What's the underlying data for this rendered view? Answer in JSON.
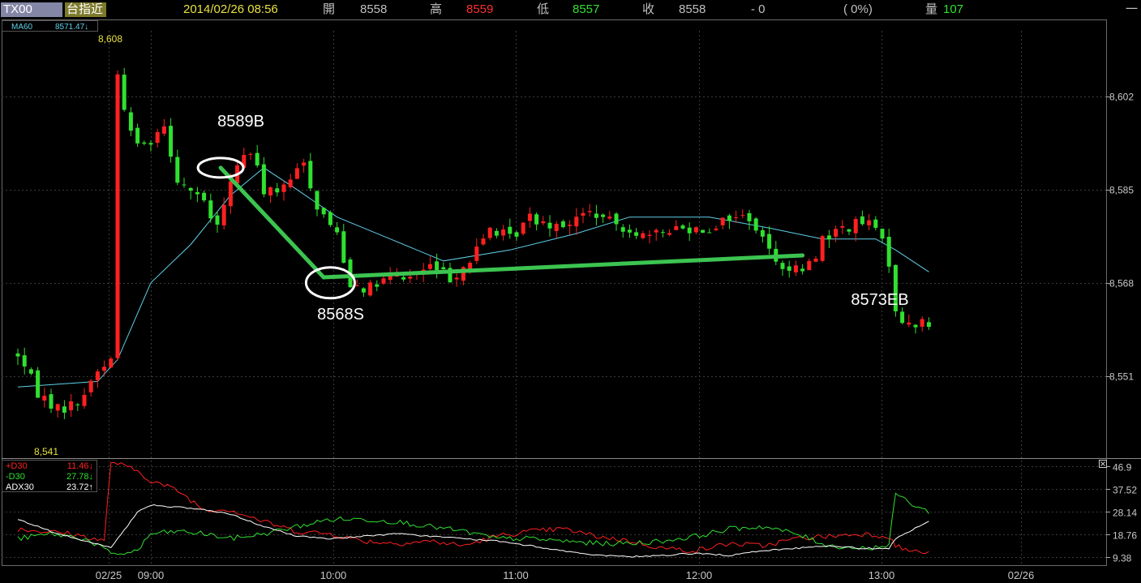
{
  "header": {
    "symbol": "TX00",
    "name": "台指近",
    "datetime": "2014/02/26 08:56",
    "open_label": "開",
    "open": "8558",
    "high_label": "高",
    "high": "8559",
    "low_label": "低",
    "low": "8557",
    "close_label": "收",
    "close": "8558",
    "change": "- 0",
    "change_pct": "( 0%)",
    "volume_label": "量",
    "volume": "107",
    "right_mark": "一"
  },
  "colors": {
    "up": "#ff2020",
    "down": "#30e030",
    "ma": "#5fd0e8",
    "grid": "#3a3a3a",
    "axis_text": "#c8c8c8",
    "plus_di": "#ff2020",
    "minus_di": "#30e030",
    "adx": "#ffffff",
    "trade_line": "#3cc450"
  },
  "chart_data": [
    {
      "type": "candlestick",
      "title": "",
      "ma_legend": {
        "label": "MA60",
        "value": "8571.47↓"
      },
      "y_ticks": [
        "8,602",
        "8,585",
        "8,568",
        "8,551"
      ],
      "ylim": [
        8536,
        8614
      ],
      "extremes": {
        "high": "8,608",
        "low": "8,541"
      },
      "x_ticks": [
        "02/25",
        "09:00",
        "10:00",
        "11:00",
        "12:00",
        "13:00",
        "02/26"
      ],
      "price_path": [
        [
          0,
          8555
        ],
        [
          3,
          8548
        ],
        [
          6,
          8545
        ],
        [
          9,
          8546
        ],
        [
          12,
          8552
        ],
        [
          14,
          8554
        ],
        [
          15,
          8606
        ],
        [
          17,
          8595
        ],
        [
          19,
          8593
        ],
        [
          22,
          8597
        ],
        [
          24,
          8587
        ],
        [
          27,
          8584
        ],
        [
          30,
          8578
        ],
        [
          33,
          8590
        ],
        [
          35,
          8592
        ],
        [
          37,
          8585
        ],
        [
          40,
          8585
        ],
        [
          43,
          8590
        ],
        [
          45,
          8582
        ],
        [
          48,
          8577
        ],
        [
          50,
          8568
        ],
        [
          53,
          8567
        ],
        [
          56,
          8569
        ],
        [
          59,
          8569
        ],
        [
          62,
          8571
        ],
        [
          65,
          8569
        ],
        [
          68,
          8572
        ],
        [
          71,
          8578
        ],
        [
          74,
          8576
        ],
        [
          77,
          8580
        ],
        [
          80,
          8579
        ],
        [
          83,
          8579
        ],
        [
          86,
          8581
        ],
        [
          89,
          8579
        ],
        [
          92,
          8578
        ],
        [
          95,
          8576
        ],
        [
          98,
          8578
        ],
        [
          101,
          8578
        ],
        [
          104,
          8578
        ],
        [
          107,
          8580
        ],
        [
          110,
          8580
        ],
        [
          113,
          8574
        ],
        [
          116,
          8570
        ],
        [
          119,
          8571
        ],
        [
          121,
          8576
        ],
        [
          124,
          8578
        ],
        [
          127,
          8579
        ],
        [
          129,
          8578
        ],
        [
          131,
          8572
        ],
        [
          132,
          8563
        ],
        [
          134,
          8560
        ],
        [
          136,
          8561
        ],
        [
          137,
          8560
        ]
      ],
      "ma60_path": [
        [
          0,
          8549
        ],
        [
          12,
          8550
        ],
        [
          15,
          8554
        ],
        [
          20,
          8568
        ],
        [
          26,
          8575
        ],
        [
          32,
          8584
        ],
        [
          37,
          8589
        ],
        [
          42,
          8585
        ],
        [
          48,
          8580
        ],
        [
          56,
          8576
        ],
        [
          64,
          8572
        ],
        [
          74,
          8574
        ],
        [
          84,
          8577
        ],
        [
          92,
          8580
        ],
        [
          104,
          8580
        ],
        [
          113,
          8578
        ],
        [
          121,
          8576
        ],
        [
          129,
          8576
        ],
        [
          132,
          8574
        ],
        [
          137,
          8570
        ]
      ],
      "annotations": [
        {
          "text": "8589B",
          "price": 8589,
          "bar": 30.5
        },
        {
          "text": "8568S",
          "price": 8568,
          "bar": 47
        },
        {
          "text": "8573EB",
          "price": 8573,
          "bar": 118
        }
      ],
      "trade_lines": [
        {
          "from": [
            30.5,
            8589
          ],
          "to": [
            46,
            8569
          ]
        },
        {
          "from": [
            46,
            8569
          ],
          "to": [
            118,
            8573
          ]
        }
      ]
    },
    {
      "type": "line",
      "title": "",
      "series": [
        {
          "name": "+D30",
          "value": "11.46↓",
          "color": "#ff2020",
          "values": [
            [
              0,
              21
            ],
            [
              8,
              19
            ],
            [
              13,
              16
            ],
            [
              14,
              49
            ],
            [
              18,
              45
            ],
            [
              20,
              41
            ],
            [
              24,
              37
            ],
            [
              28,
              29
            ],
            [
              32,
              29
            ],
            [
              37,
              24
            ],
            [
              42,
              20
            ],
            [
              47,
              19
            ],
            [
              52,
              16
            ],
            [
              57,
              15
            ],
            [
              62,
              16
            ],
            [
              67,
              14
            ],
            [
              72,
              18
            ],
            [
              77,
              20
            ],
            [
              82,
              21
            ],
            [
              87,
              18
            ],
            [
              92,
              16
            ],
            [
              97,
              13
            ],
            [
              102,
              12
            ],
            [
              107,
              15
            ],
            [
              112,
              14
            ],
            [
              117,
              17
            ],
            [
              122,
              18
            ],
            [
              127,
              19
            ],
            [
              131,
              18
            ],
            [
              132,
              14
            ],
            [
              134,
              12
            ],
            [
              137,
              11
            ]
          ]
        },
        {
          "name": "-D30",
          "value": "27.78↓",
          "color": "#30e030",
          "values": [
            [
              0,
              17
            ],
            [
              5,
              19
            ],
            [
              10,
              17
            ],
            [
              13,
              13
            ],
            [
              14,
              10
            ],
            [
              18,
              12
            ],
            [
              20,
              19
            ],
            [
              24,
              20
            ],
            [
              28,
              19
            ],
            [
              32,
              17
            ],
            [
              37,
              19
            ],
            [
              42,
              22
            ],
            [
              47,
              25
            ],
            [
              52,
              25
            ],
            [
              57,
              24
            ],
            [
              62,
              22
            ],
            [
              67,
              20
            ],
            [
              72,
              17
            ],
            [
              77,
              17
            ],
            [
              82,
              16
            ],
            [
              87,
              15
            ],
            [
              92,
              15
            ],
            [
              97,
              16
            ],
            [
              102,
              18
            ],
            [
              107,
              21
            ],
            [
              112,
              22
            ],
            [
              117,
              19
            ],
            [
              122,
              14
            ],
            [
              127,
              13
            ],
            [
              131,
              14
            ],
            [
              132,
              36
            ],
            [
              134,
              32
            ],
            [
              137,
              28
            ]
          ]
        },
        {
          "name": "ADX30",
          "value": "23.72↑",
          "color": "#ffffff",
          "values": [
            [
              0,
              25
            ],
            [
              5,
              20
            ],
            [
              10,
              16
            ],
            [
              13,
              14
            ],
            [
              14,
              13
            ],
            [
              18,
              28
            ],
            [
              20,
              31
            ],
            [
              24,
              30
            ],
            [
              28,
              29
            ],
            [
              32,
              27
            ],
            [
              37,
              22
            ],
            [
              42,
              18
            ],
            [
              47,
              17
            ],
            [
              52,
              18
            ],
            [
              57,
              19
            ],
            [
              62,
              18
            ],
            [
              67,
              17
            ],
            [
              72,
              16
            ],
            [
              77,
              14
            ],
            [
              82,
              12
            ],
            [
              87,
              10
            ],
            [
              92,
              9.5
            ],
            [
              97,
              10
            ],
            [
              102,
              11
            ],
            [
              107,
              10
            ],
            [
              112,
              12
            ],
            [
              117,
              13
            ],
            [
              122,
              14
            ],
            [
              127,
              13
            ],
            [
              131,
              13
            ],
            [
              132,
              17
            ],
            [
              134,
              20
            ],
            [
              137,
              24
            ]
          ]
        }
      ],
      "y_ticks": [
        "46.9",
        "37.52",
        "28.14",
        "18.76",
        "9.38"
      ],
      "ylim": [
        6,
        50
      ],
      "close_icon": "close-box-icon"
    }
  ]
}
